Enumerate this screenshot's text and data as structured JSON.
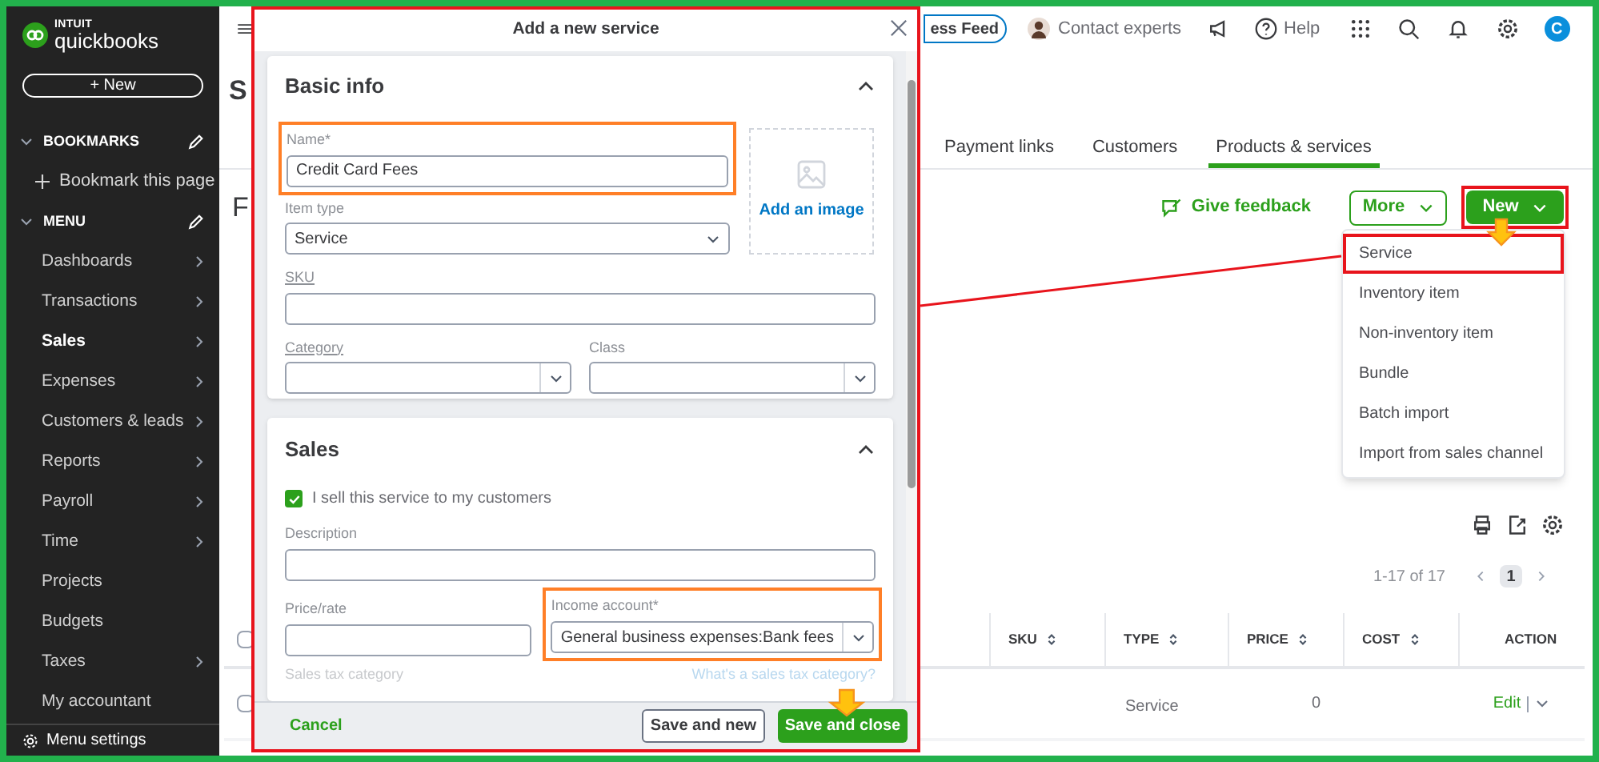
{
  "sidebar": {
    "logo": {
      "brand": "INTUIT",
      "product": "quickbooks"
    },
    "new_button": "+ New",
    "bookmarks": {
      "label": "BOOKMARKS",
      "expanded": true,
      "items": [
        {
          "label": "Bookmark this page"
        }
      ]
    },
    "menu": {
      "label": "MENU",
      "expanded": true,
      "items": [
        {
          "label": "Dashboards",
          "selected": false,
          "has_submenu": true
        },
        {
          "label": "Transactions",
          "selected": false,
          "has_submenu": true
        },
        {
          "label": "Sales",
          "selected": true,
          "has_submenu": true
        },
        {
          "label": "Expenses",
          "selected": false,
          "has_submenu": true
        },
        {
          "label": "Customers & leads",
          "selected": false,
          "has_submenu": true
        },
        {
          "label": "Reports",
          "selected": false,
          "has_submenu": true
        },
        {
          "label": "Payroll",
          "selected": false,
          "has_submenu": true
        },
        {
          "label": "Time",
          "selected": false,
          "has_submenu": true
        },
        {
          "label": "Projects",
          "selected": false,
          "has_submenu": false
        },
        {
          "label": "Budgets",
          "selected": false,
          "has_submenu": false
        },
        {
          "label": "Taxes",
          "selected": false,
          "has_submenu": true
        },
        {
          "label": "My accountant",
          "selected": false,
          "has_submenu": false
        }
      ]
    },
    "menu_settings": "Menu settings"
  },
  "main": {
    "top_bar": {
      "feed_button": "ess Feed",
      "contact": "Contact experts",
      "help": "Help",
      "avatar": "C"
    },
    "page_title": "S",
    "section_title": "F",
    "tabs": [
      {
        "label": "Payment links",
        "selected": false
      },
      {
        "label": "Customers",
        "selected": false
      },
      {
        "label": "Products & services",
        "selected": true
      }
    ],
    "feedback_link": "Give feedback",
    "more_button": "More",
    "new_button": {
      "label": "New",
      "marked": true
    },
    "new_menu": [
      {
        "label": "Service",
        "marked": true
      },
      {
        "label": "Inventory item",
        "marked": false
      },
      {
        "label": "Non-inventory item",
        "marked": false
      },
      {
        "label": "Bundle",
        "marked": false
      },
      {
        "label": "Batch import",
        "marked": false
      },
      {
        "label": "Import from sales channel",
        "marked": false
      }
    ],
    "pagination": {
      "range": "1-17 of 17",
      "current_page": "1"
    },
    "table": {
      "select_all_checked": false,
      "columns": [
        {
          "label": "SKU",
          "sortable": true
        },
        {
          "label": "TYPE",
          "sortable": true
        },
        {
          "label": "PRICE",
          "sortable": true
        },
        {
          "label": "COST",
          "sortable": true
        },
        {
          "label": "ACTION",
          "sortable": false
        }
      ],
      "rows": [
        {
          "checked": false,
          "type": "Service",
          "price": "0",
          "action": "Edit"
        }
      ]
    }
  },
  "modal": {
    "title": "Add a new service",
    "basic_info": {
      "title": "Basic info",
      "expanded": true,
      "name": {
        "label": "Name*",
        "value": "Credit Card Fees",
        "marked": true
      },
      "item_type": {
        "label": "Item type",
        "value": "Service"
      },
      "image_button": "Add an image",
      "sku": {
        "label": "SKU"
      },
      "category": {
        "label": "Category"
      },
      "class": {
        "label": "Class"
      }
    },
    "sales": {
      "title": "Sales",
      "expanded": true,
      "sell_checkbox": {
        "label": "I sell this service to my customers",
        "checked": true
      },
      "description": {
        "label": "Description"
      },
      "price": {
        "label": "Price/rate"
      },
      "income_account": {
        "label": "Income account*",
        "value": "General business expenses:Bank fees",
        "marked": true
      },
      "tax_category": {
        "label": "Sales tax category"
      },
      "tax_help_link": "What's a sales tax category?"
    },
    "footer": {
      "cancel": "Cancel",
      "save_new": "Save and new",
      "save_close": "Save and close"
    }
  }
}
